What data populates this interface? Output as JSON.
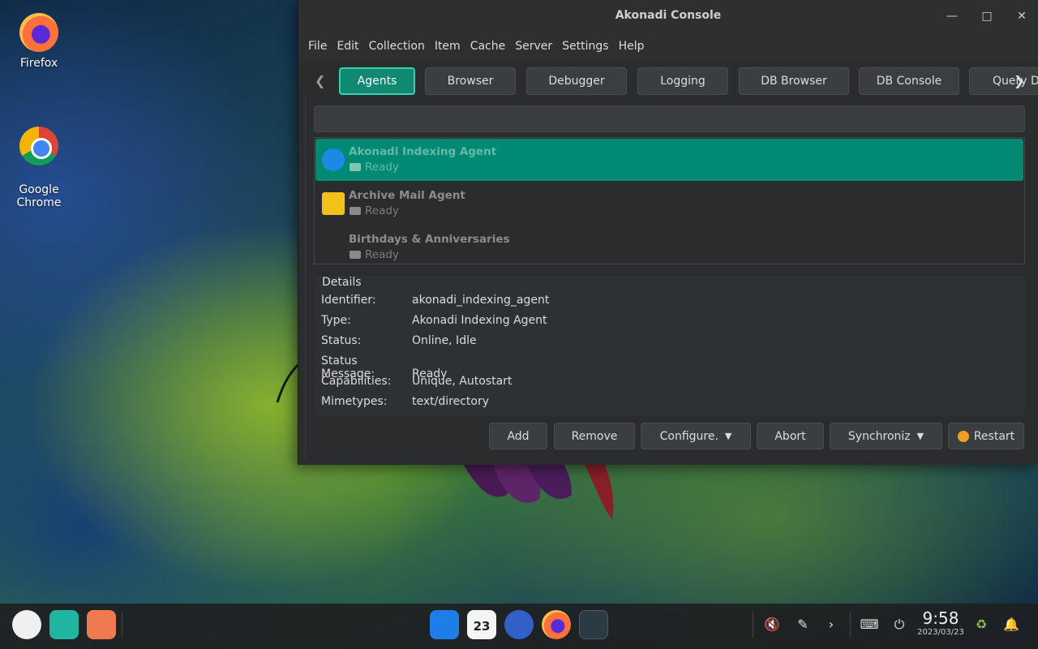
{
  "desktop": {
    "icons": [
      {
        "label": "Firefox"
      },
      {
        "label": "Google\nChrome"
      }
    ]
  },
  "window": {
    "title": "Akonadi Console",
    "controls": {
      "minimize": "—",
      "maximize": "□",
      "close": "✕"
    },
    "menu": [
      "File",
      "Edit",
      "Collection",
      "Item",
      "Cache",
      "Server",
      "Settings",
      "Help"
    ],
    "tabs": [
      "Agents",
      "Browser",
      "Debugger",
      "Logging",
      "DB Browser",
      "DB Console",
      "Query D"
    ],
    "active_tab": "Agents",
    "search": {
      "value": ""
    },
    "agents": [
      {
        "name": "Akonadi Indexing Agent",
        "status": "Ready",
        "selected": true
      },
      {
        "name": "Archive Mail Agent",
        "status": "Ready",
        "selected": false
      },
      {
        "name": "Birthdays & Anniversaries",
        "status": "Ready",
        "selected": false
      }
    ],
    "details": {
      "title": "Details",
      "rows": [
        {
          "label": "Identifier:",
          "value": "akonadi_indexing_agent"
        },
        {
          "label": "Type:",
          "value": "Akonadi Indexing Agent"
        },
        {
          "label": "Status:",
          "value": "Online, Idle"
        },
        {
          "label": "Status Message:",
          "value": "Ready"
        },
        {
          "label": "Capabilities:",
          "value": "Unique, Autostart"
        },
        {
          "label": "Mimetypes:",
          "value": "text/directory"
        }
      ]
    },
    "buttons": {
      "add": "Add",
      "remove": "Remove",
      "configure": "Configure.",
      "abort": "Abort",
      "synchronize": "Synchroniz",
      "restart": "Restart"
    }
  },
  "taskbar": {
    "calendar_day": "23",
    "clock": {
      "time": "9:58",
      "date": "2023/03/23"
    }
  },
  "colors": {
    "accent": "#008a74",
    "window_bg": "#2a2c2e"
  }
}
